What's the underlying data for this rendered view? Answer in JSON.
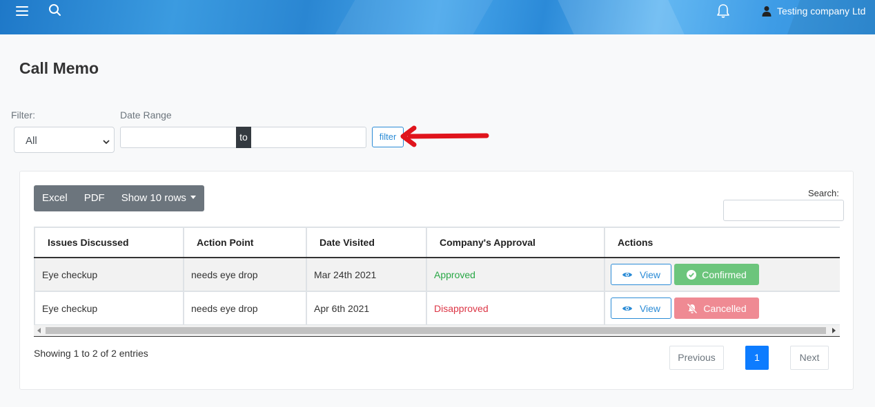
{
  "topbar": {
    "menu_icon": "hamburger-icon",
    "search_icon": "search-icon",
    "bell_icon": "bell-icon",
    "user_icon": "user-icon",
    "user_name": "Testing company Ltd"
  },
  "page": {
    "title": "Call Memo"
  },
  "filter": {
    "label": "Filter:",
    "selected": "All",
    "date_range_label": "Date Range",
    "date_from": "",
    "to_label": "to",
    "date_to": "",
    "button_label": "filter"
  },
  "toolbar": {
    "excel": "Excel",
    "pdf": "PDF",
    "show_rows": "Show 10 rows",
    "search_label": "Search:",
    "search_value": ""
  },
  "table": {
    "columns": [
      "Issues Discussed",
      "Action Point",
      "Date Visited",
      "Company's Approval",
      "Actions"
    ],
    "rows": [
      {
        "issue": "Eye checkup",
        "action_point": "needs eye drop",
        "date": "Mar 24th 2021",
        "approval": "Approved",
        "view": "View",
        "status": "Confirmed"
      },
      {
        "issue": "Eye checkup",
        "action_point": "needs eye drop",
        "date": "Apr 6th 2021",
        "approval": "Disapproved",
        "view": "View",
        "status": "Cancelled"
      }
    ]
  },
  "footer": {
    "info": "Showing 1 to 2 of 2 entries",
    "previous": "Previous",
    "page": "1",
    "next": "Next"
  },
  "colors": {
    "primary": "#2a8bd6",
    "approved": "#28a745",
    "disapproved": "#dc3545",
    "confirmed_bg": "#6cc57c",
    "cancelled_bg": "#ef8a93",
    "annotation_arrow": "#e0141c"
  }
}
